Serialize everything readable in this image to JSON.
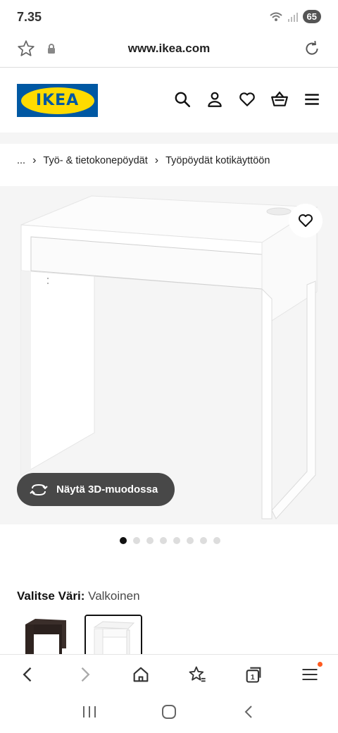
{
  "status": {
    "time": "7.35",
    "battery": "65"
  },
  "browser": {
    "url": "www.ikea.com"
  },
  "brand": {
    "logo_text": "IKEA",
    "blue": "#0058a3",
    "yellow": "#ffdb00"
  },
  "breadcrumb": {
    "items": [
      "...",
      "Työ- & tietokonepöydät",
      "Työpöydät kotikäyttöön"
    ],
    "separator": "›"
  },
  "product": {
    "view3d_label": "Näytä 3D-muodossa",
    "gallery_count": 8,
    "gallery_active": 0
  },
  "color": {
    "label": "Valitse Väri:",
    "value": "Valkoinen",
    "swatches": [
      "dark",
      "white"
    ],
    "selected_index": 1
  },
  "icons": {
    "header": [
      "search-icon",
      "user-icon",
      "heart-icon",
      "basket-icon",
      "menu-icon"
    ],
    "browser_nav": [
      "back-icon",
      "forward-icon",
      "home-icon",
      "bookmarks-icon",
      "tabs-icon",
      "browser-menu-icon"
    ],
    "tabs_count": "1"
  }
}
